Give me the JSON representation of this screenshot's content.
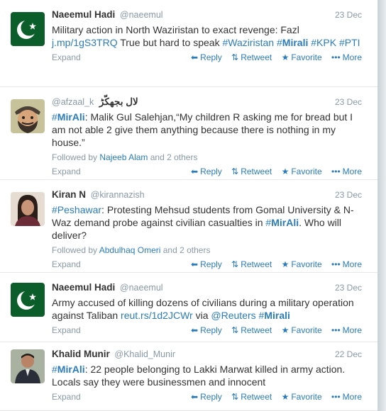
{
  "actions": {
    "reply": "Reply",
    "retweet": "Retweet",
    "favorite": "Favorite",
    "more": "More",
    "expand": "Expand"
  },
  "tweets": [
    {
      "fullname": "Naeemul Hadi",
      "username": "@naeemul",
      "time": "23 Dec",
      "segments": [
        {
          "t": "text",
          "v": "Military action in North Waziristan to exact revenge: Fazl "
        },
        {
          "t": "link",
          "v": "j.mp/1gS3TRQ"
        },
        {
          "t": "text",
          "v": " True but hard to speak "
        },
        {
          "t": "tag",
          "v": "#Waziristan"
        },
        {
          "t": "text",
          "v": " "
        },
        {
          "t": "tagb",
          "pre": "#",
          "v": "Mirali"
        },
        {
          "t": "text",
          "v": " "
        },
        {
          "t": "tag",
          "v": "#KPK"
        },
        {
          "t": "text",
          "v": " "
        },
        {
          "t": "tag",
          "v": "#PTI"
        }
      ],
      "followed": null
    },
    {
      "fullname": "",
      "username": "@afzaal_k",
      "name_rtl": "لال بجھکّڑ",
      "time": "23 Dec",
      "segments": [
        {
          "t": "tagb",
          "pre": "#",
          "v": "MirAli"
        },
        {
          "t": "text",
          "v": ": Malik Gul Salehjan,“My children R asking me for bread but I am not able 2 give them anything because there is nothing in my house.”"
        }
      ],
      "followed": {
        "prefix": "Followed by ",
        "name": "Najeeb Alam",
        "suffix": " and 2 others"
      }
    },
    {
      "fullname": "Kiran N",
      "username": "@kirannazish",
      "time": "23 Dec",
      "segments": [
        {
          "t": "tag",
          "v": "#Peshawar"
        },
        {
          "t": "text",
          "v": ": Protesting Mehsud students from Gomal University & N-Waz demand probe against civilian casualties in "
        },
        {
          "t": "tagb",
          "pre": "#",
          "v": "MirAli"
        },
        {
          "t": "text",
          "v": ". Who will deliver?"
        }
      ],
      "followed": {
        "prefix": "Followed by ",
        "name": "Abdulhaq Omeri",
        "suffix": " and 2 others"
      }
    },
    {
      "fullname": "Naeemul Hadi",
      "username": "@naeemul",
      "time": "23 Dec",
      "segments": [
        {
          "t": "text",
          "v": "Army accused of killing dozens of civilians during a military operation against Taliban "
        },
        {
          "t": "link",
          "v": "reut.rs/1d2JCWr"
        },
        {
          "t": "text",
          "v": " via "
        },
        {
          "t": "link",
          "v": "@Reuters"
        },
        {
          "t": "text",
          "v": " "
        },
        {
          "t": "tagb",
          "pre": "#",
          "v": "Mirali"
        }
      ],
      "followed": null
    },
    {
      "fullname": "Khalid Munir",
      "username": "@Khalid_Munir",
      "time": "22 Dec",
      "segments": [
        {
          "t": "tagb",
          "pre": "#",
          "v": "MirAli"
        },
        {
          "t": "text",
          "v": ": 22 people belonging to Lakki Marwat killed in army action. Locals say they were businessmen and innocent"
        }
      ],
      "followed": null
    }
  ]
}
